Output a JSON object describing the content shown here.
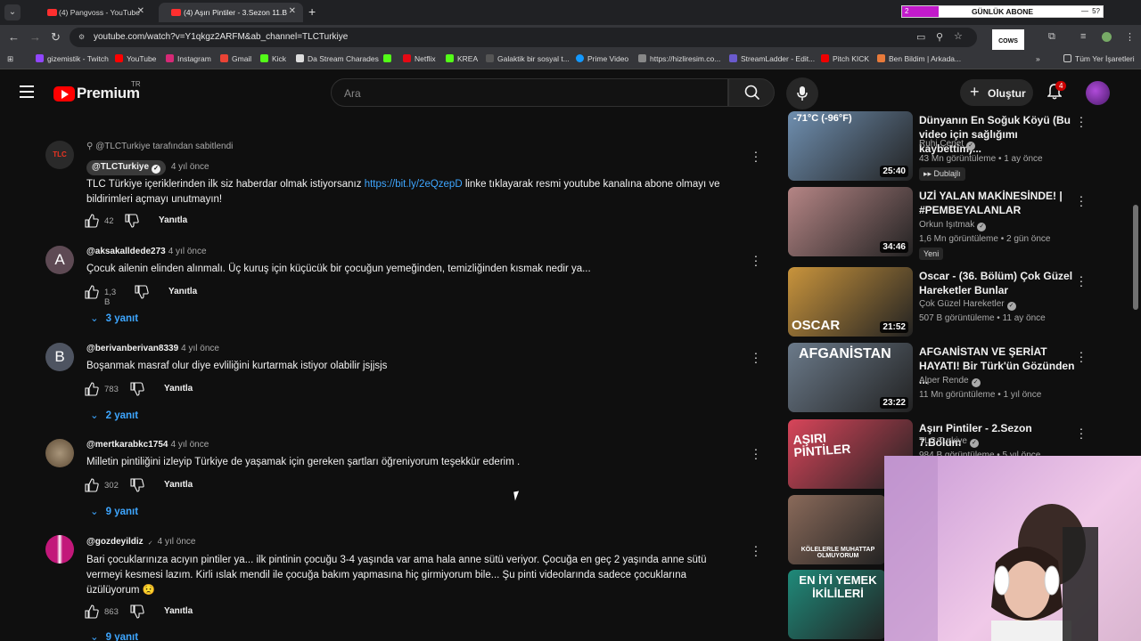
{
  "browser": {
    "tabs": [
      {
        "title": "(4) Pangvoss - YouTube",
        "active": false
      },
      {
        "title": "(4) Aşırı Pintiler - 3.Sezon 11.B",
        "active": true
      }
    ],
    "address": "youtube.com/watch?v=Y1qkgz2ARFM&ab_channel=TLCTurkiye",
    "bookmarks": [
      "gizemistik - Twitch",
      "YouTube",
      "Instagram",
      "Gmail",
      "Kick",
      "Da Stream Charades",
      "Netflix",
      "KREA",
      "Galaktik bir sosyal t...",
      "Prime Video",
      "https://hizliresim.co...",
      "StreamLadder - Edit...",
      "Pitch KICK",
      "Ben Bildim | Arkada..."
    ],
    "all_bookmarks": "Tüm Yer İşaretleri",
    "overlay_logo": "COWS"
  },
  "subgoal": {
    "label": "GÜNLÜK ABONE",
    "left": "2",
    "middle": "—",
    "right": "5?",
    "progress": 0.18
  },
  "header": {
    "premium": "Premium",
    "region": "TR",
    "search_placeholder": "Ara",
    "create_label": "Oluştur",
    "notif_count": "4"
  },
  "comments": [
    {
      "pinned_label": "@TLCTurkiye tarafından sabitlendi",
      "handle": "@TLCTurkiye",
      "time": "4 yıl önce",
      "text_before": "TLC Türkiye içeriklerinden ilk siz haberdar olmak istiyorsanız ",
      "link": "https://bit.ly/2eQzepD",
      "text_after": " linke tıklayarak resmi youtube kanalına abone olmayı ve bildirimleri açmayı unutmayın!",
      "likes": "42",
      "reply_label": "Yanıtla",
      "avatar": "TLC",
      "avatar_color": "#2a2a2a"
    },
    {
      "handle": "@aksakalldede273",
      "time": "4 yıl önce",
      "text": "Çocuk ailenin elinden alınmalı. Üç kuruş için küçücük bir çocuğun yemeğinden, temizliğinden kısmak nedir ya...",
      "likes": "1,3 B",
      "reply_label": "Yanıtla",
      "replies": "3 yanıt",
      "avatar": "A",
      "avatar_color": "#5e4a54"
    },
    {
      "handle": "@berivanberivan8339",
      "time": "4 yıl önce",
      "text": "Boşanmak masraf olur diye evliliğini kurtarmak istiyor olabilir jsjjsjs",
      "likes": "783",
      "reply_label": "Yanıtla",
      "replies": "2 yanıt",
      "avatar": "B",
      "avatar_color": "#4e5461"
    },
    {
      "handle": "@mertkarabkc1754",
      "time": "4 yıl önce",
      "text": "Milletin pintiliğini izleyip Türkiye de yaşamak için gereken şartları öğreniyorum teşekkür ederim .",
      "likes": "302",
      "reply_label": "Yanıtla",
      "replies": "9 yanıt",
      "avatar": "",
      "avatar_color": "#7a6a52"
    },
    {
      "handle": "@gozdeyildiz",
      "time": "4 yıl önce",
      "text": "Bari çocuklarınıza acıyın pintiler ya... ilk pintinin çocuğu 3-4 yaşında var ama hala anne sütü veriyor. Çocuğa en geç 2 yaşında anne sütü vermeyi kesmesi lazım.  Kirli ıslak mendil ile çocuğa bakım yapmasına hiç girmiyorum bile... Şu pinti videolarında sadece çocuklarına üzülüyorum 😟",
      "likes": "863",
      "reply_label": "Yanıtla",
      "replies": "9 yanıt",
      "avatar": "",
      "avatar_color": "#c2187a"
    }
  ],
  "videos": [
    {
      "title": "Dünyanın En Soğuk Köyü (Bu video için sağlığımı kaybettim)...",
      "channel": "Ruhi Çenet",
      "meta": "43 Mn görüntüleme • 1 ay önce",
      "badge": "Dublajlı",
      "duration": "25:40",
      "thumb_text": "-71°C (-96°F)",
      "color": "#6f8fb0"
    },
    {
      "title": "UZİ YALAN MAKİNESİNDE! | #PEMBEYALANLAR",
      "channel": "Orkun Işıtmak",
      "meta": "1,6 Mn görüntüleme • 2 gün önce",
      "badge": "Yeni",
      "duration": "34:46",
      "thumb_text": "",
      "color": "#b58585"
    },
    {
      "title": "Oscar - (36. Bölüm) Çok Güzel Hareketler Bunlar",
      "channel": "Çok Güzel Hareketler",
      "meta": "507 B görüntüleme • 11 ay önce",
      "badge": "",
      "duration": "21:52",
      "thumb_text": "OSCAR",
      "color": "#c9943c"
    },
    {
      "title": "AFGANİSTAN VE ŞERİAT HAYATI! Bir Türk'ün Gözünden ...",
      "channel": "Alper Rende",
      "meta": "11 Mn görüntüleme • 1 yıl önce",
      "badge": "",
      "duration": "23:22",
      "thumb_text": "AFGANİSTAN",
      "color": "#6b7a8a"
    },
    {
      "title": "Aşırı Pintiler - 2.Sezon 7.Bölüm",
      "channel": "TLC Turkiye",
      "meta": "984 B görüntüleme • 5 yıl önce",
      "badge": "",
      "duration": "",
      "thumb_text": "AŞIRI PİNTİLER",
      "color": "#d8455a"
    },
    {
      "title": "",
      "channel": "",
      "meta": "",
      "badge": "",
      "duration": "",
      "thumb_text": "KÖLELERLE MUHATTAP OLMUYORUM",
      "color": "#8a6a5a"
    },
    {
      "title": "",
      "channel": "",
      "meta": "",
      "badge": "",
      "duration": "",
      "thumb_text": "EN İYİ YEMEK İKİLİLERİ",
      "color": "#1f8a7a"
    }
  ]
}
